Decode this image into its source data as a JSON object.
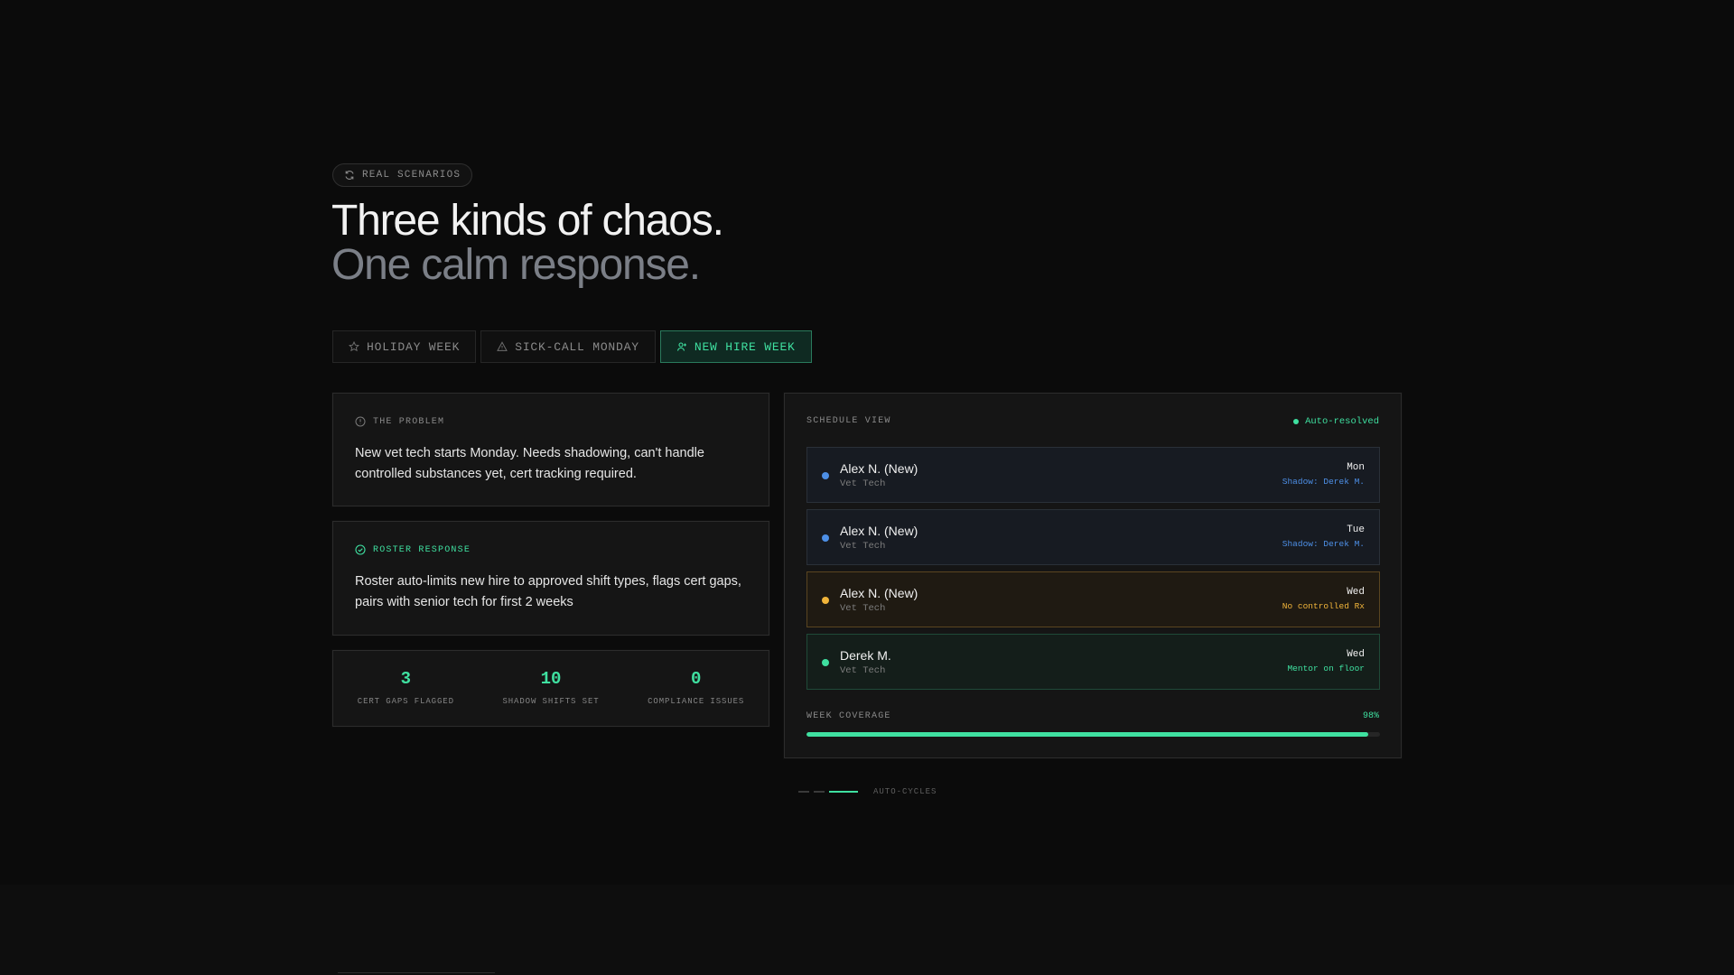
{
  "badge": {
    "label": "REAL SCENARIOS",
    "icon": "refresh-icon"
  },
  "headline": {
    "line1": "Three kinds of chaos.",
    "line2": "One calm response."
  },
  "tabs": [
    {
      "label": "HOLIDAY WEEK",
      "icon": "star-icon",
      "active": false
    },
    {
      "label": "SICK-CALL MONDAY",
      "icon": "warning-icon",
      "active": false
    },
    {
      "label": "NEW HIRE WEEK",
      "icon": "user-plus-icon",
      "active": true
    }
  ],
  "problem": {
    "title": "THE PROBLEM",
    "body": "New vet tech starts Monday. Needs shadowing, can't handle controlled substances yet, cert tracking required."
  },
  "response": {
    "title": "ROSTER RESPONSE",
    "body": "Roster auto-limits new hire to approved shift types, flags cert gaps, pairs with senior tech for first 2 weeks"
  },
  "stats": [
    {
      "value": "3",
      "label": "CERT GAPS FLAGGED"
    },
    {
      "value": "10",
      "label": "SHADOW SHIFTS SET"
    },
    {
      "value": "0",
      "label": "COMPLIANCE ISSUES"
    }
  ],
  "schedule": {
    "title": "SCHEDULE VIEW",
    "status": "Auto-resolved",
    "rows": [
      {
        "name": "Alex N. (New)",
        "role": "Vet Tech",
        "day": "Mon",
        "note": "Shadow: Derek M."
      },
      {
        "name": "Alex N. (New)",
        "role": "Vet Tech",
        "day": "Tue",
        "note": "Shadow: Derek M."
      },
      {
        "name": "Alex N. (New)",
        "role": "Vet Tech",
        "day": "Wed",
        "note": "No controlled Rx"
      },
      {
        "name": "Derek M.",
        "role": "Vet Tech",
        "day": "Wed",
        "note": "Mentor on floor"
      }
    ],
    "coverage_label": "WEEK COVERAGE",
    "coverage_value": "98%",
    "coverage_fraction": 0.98
  },
  "cycles_label": "AUTO-CYCLES",
  "colors": {
    "accent": "#3fe0a0",
    "info": "#4d8fe6",
    "warning": "#f0b43a",
    "background": "#0b0b0b"
  }
}
